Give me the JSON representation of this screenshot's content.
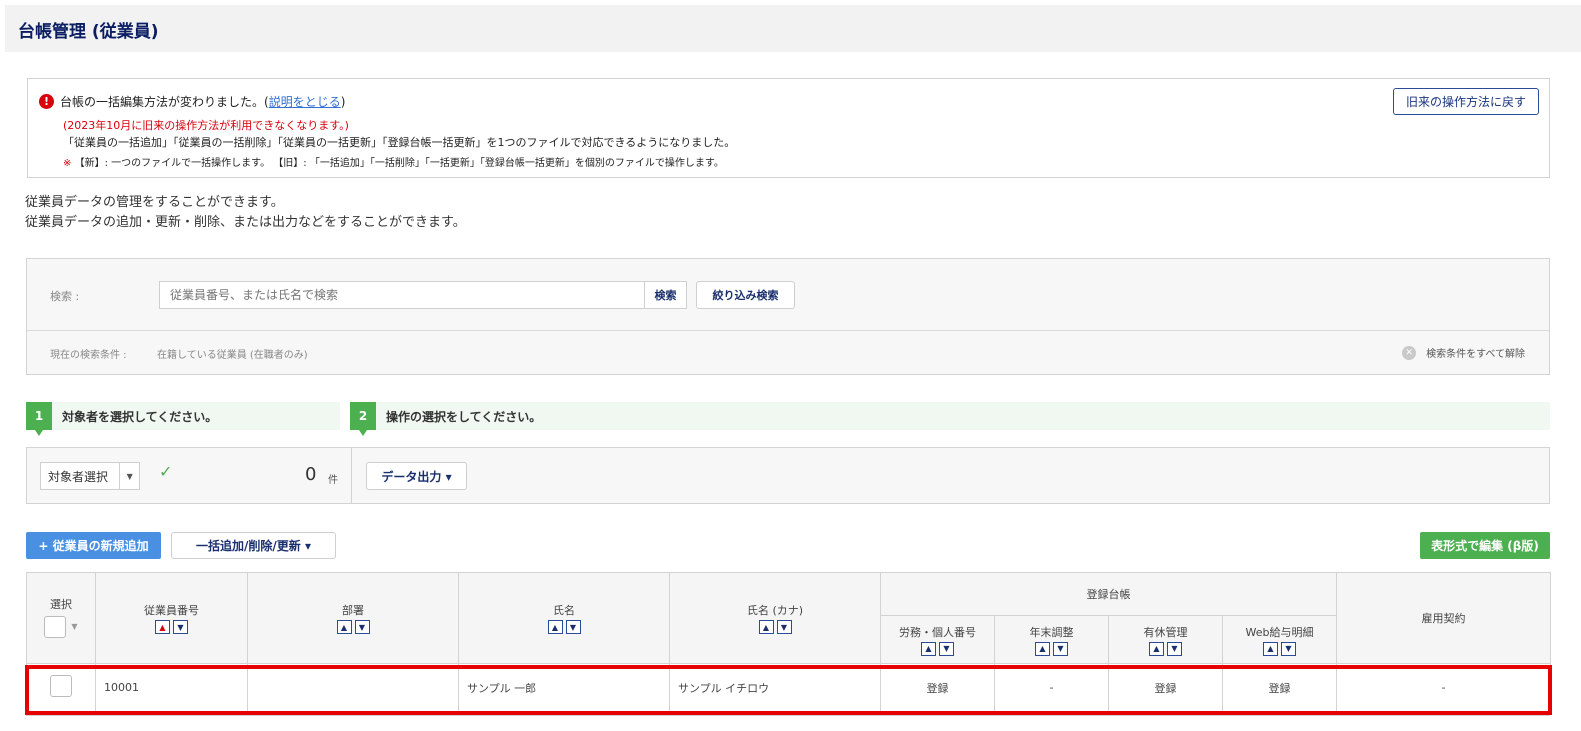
{
  "header": {
    "title": "台帳管理 (従業員)"
  },
  "notice": {
    "line1_before": "台帳の一括編集方法が変わりました。(",
    "line1_link": "説明をとじる",
    "line1_after": ")",
    "red_line": "(2023年10月に旧来の操作方法が利用できなくなります。)",
    "line3": "「従業員の一括追加」「従業員の一括削除」「従業員の一括更新」「登録台帳一括更新」を1つのファイルで対応できるようになりました。",
    "line4_mark": "※",
    "line4": "【新】: 一つのファイルで一括操作します。 【旧】: 「一括追加」「一括削除」「一括更新」「登録台帳一括更新」を個別のファイルで操作します。",
    "old_method_button": "旧来の操作方法に戻す"
  },
  "description": {
    "line1": "従業員データの管理をすることができます。",
    "line2": "従業員データの追加・更新・削除、または出力などをすることができます。"
  },
  "search": {
    "label": "検索 :",
    "placeholder": "従業員番号、または氏名で検索",
    "search_button": "検索",
    "filter_button": "絞り込み検索",
    "condition_label": "現在の検索条件 :",
    "condition_value": "在籍している従業員 (在職者のみ)",
    "clear_all": "検索条件をすべて解除"
  },
  "steps": {
    "step1_num": "1",
    "step1_label": "対象者を選択してください。",
    "step2_num": "2",
    "step2_label": "操作の選択をしてください。"
  },
  "selection": {
    "target_select": "対象者選択",
    "count": "0",
    "count_unit": "件",
    "export_button": "データ出力 ▾"
  },
  "actions": {
    "add_employee": "+ 従業員の新規追加",
    "bulk_button": "一括追加/削除/更新 ▾",
    "table_edit": "表形式で編集 (β版)"
  },
  "table": {
    "headers": {
      "select": "選択",
      "employee_no": "従業員番号",
      "department": "部署",
      "name": "氏名",
      "name_kana": "氏名 (カナ)",
      "registry_group": "登録台帳",
      "labor": "労務・個人番号",
      "year_end": "年末調整",
      "paid_leave": "有休管理",
      "web_payslip": "Web給与明細",
      "employment_contract": "雇用契約"
    },
    "rows": [
      {
        "employee_no": "10001",
        "department": "",
        "name": "サンプル 一郎",
        "name_kana": "サンプル イチロウ",
        "labor": "登録",
        "year_end": "-",
        "paid_leave": "登録",
        "web_payslip": "登録",
        "employment_contract": "-"
      }
    ]
  },
  "colors": {
    "header_text": "#0b1e63",
    "accent_green": "#4caf50",
    "accent_blue": "#4a90e2",
    "alert_red": "#d9000d",
    "highlight_red": "#e60000"
  },
  "icons": {
    "alert": "alert-circle-icon",
    "clear": "clear-circle-icon",
    "check": "check-icon",
    "sort_up": "chevron-up-icon",
    "sort_down": "chevron-down-icon"
  }
}
